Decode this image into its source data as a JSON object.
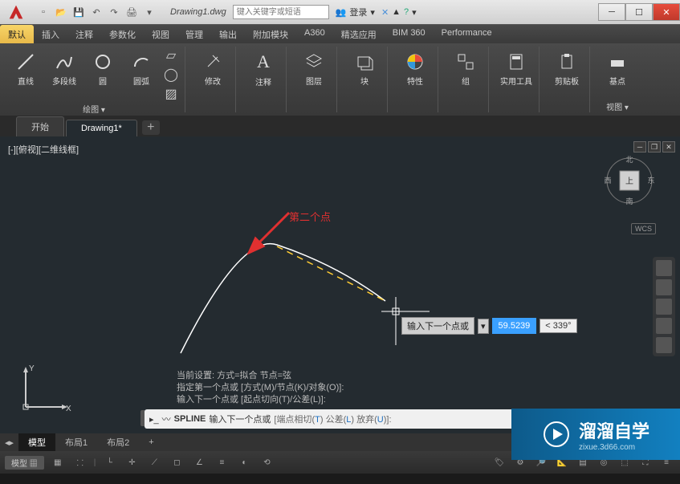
{
  "title_filename": "Drawing1.dwg",
  "search": {
    "placeholder": "键入关键字或短语"
  },
  "titlebar": {
    "login": "登录",
    "help_drop": "?"
  },
  "ribbon_tabs": [
    "默认",
    "插入",
    "注释",
    "参数化",
    "视图",
    "管理",
    "输出",
    "附加模块",
    "A360",
    "精选应用",
    "BIM 360",
    "Performance"
  ],
  "active_ribbon_tab": 0,
  "panels": {
    "draw": {
      "title": "绘图 ▾",
      "btns": [
        "直线",
        "多段线",
        "圆",
        "圆弧"
      ]
    },
    "modify": {
      "title": "修改"
    },
    "annotate": {
      "title": "注释"
    },
    "layers": {
      "title": "图层"
    },
    "block": {
      "title": "块"
    },
    "properties": {
      "title": "特性"
    },
    "groups": {
      "title": "组"
    },
    "utilities": {
      "title": "实用工具"
    },
    "clipboard": {
      "title": "剪贴板"
    },
    "view": {
      "title": "视图 ▾",
      "btn": "基点"
    }
  },
  "file_tabs": {
    "start": "开始",
    "drawing": "Drawing1*",
    "add": "+"
  },
  "view_label": "[-][俯视][二维线框]",
  "viewcube": {
    "n": "北",
    "s": "南",
    "e": "东",
    "w": "西",
    "top": "上"
  },
  "wcs": "WCS",
  "annotation_text": "第二个点",
  "dynamic_input": {
    "prompt": "输入下一个点或",
    "distance": "59.5239",
    "angle": "< 339°"
  },
  "cmd_history": [
    "当前设置: 方式=拟合   节点=弦",
    "指定第一个点或 [方式(M)/节点(K)/对象(O)]:",
    "输入下一个点或 [起点切向(T)/公差(L)]:"
  ],
  "cmdline": {
    "cmd": "SPLINE",
    "prompt": "输入下一个点或",
    "opts": [
      {
        "label": "端点相切",
        "key": "T"
      },
      {
        "label": "公差",
        "key": "L"
      },
      {
        "label": "放弃",
        "key": "U"
      }
    ]
  },
  "model_tabs": [
    "模型",
    "布局1",
    "布局2"
  ],
  "status": {
    "space": "模型 ▦"
  },
  "watermark": {
    "main": "溜溜自学",
    "sub": "zixue.3d66.com"
  }
}
